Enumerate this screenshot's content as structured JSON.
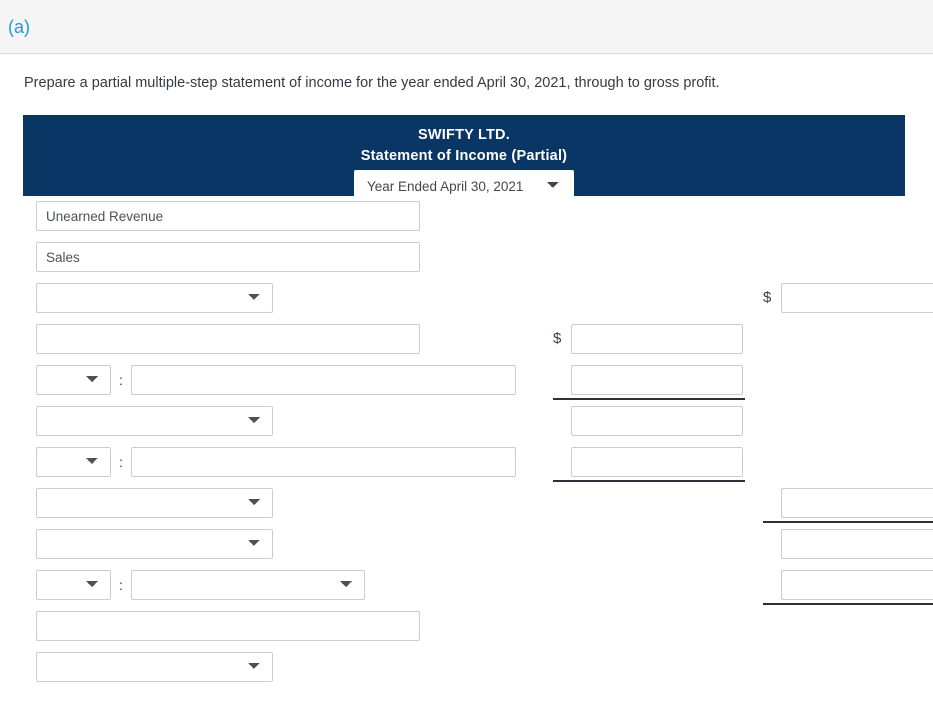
{
  "part": {
    "label": "(a)"
  },
  "instruction": "Prepare a partial multiple-step statement of income for the year ended April 30, 2021, through to gross profit.",
  "statement_header": {
    "company": "SWIFTY LTD.",
    "title": "Statement of Income (Partial)",
    "period_selected": "Year Ended April 30, 2021",
    "period_options": [
      "Year Ended April 30, 2021"
    ],
    "background_color": "#0a3665",
    "text_color": "#ffffff"
  },
  "colors": {
    "accent_link": "#1c9bdf",
    "band_background": "#f5f5f5",
    "header_navy": "#0a3665",
    "input_border": "#c9cdd1",
    "rule": "#2b3138"
  },
  "colon_symbol": ":",
  "dollar_symbol": "$",
  "rows": [
    {
      "index": 0,
      "left": {
        "kind": "text",
        "value": "Unearned Revenue",
        "placeholder": ""
      },
      "mid": null,
      "right": null
    },
    {
      "index": 1,
      "left": {
        "kind": "text",
        "value": "Sales",
        "placeholder": ""
      },
      "mid": null,
      "right": null
    },
    {
      "index": 2,
      "left": {
        "kind": "select",
        "value": "",
        "options": [
          ""
        ]
      },
      "mid": null,
      "right": {
        "kind": "amount",
        "value": "",
        "dollar": true,
        "rule_below": false
      }
    },
    {
      "index": 3,
      "left": {
        "kind": "text",
        "value": "",
        "placeholder": ""
      },
      "mid": {
        "kind": "amount",
        "value": "",
        "dollar": true,
        "rule_below": false
      },
      "right": null
    },
    {
      "index": 4,
      "left": {
        "kind": "select-colon-text",
        "select_value": "",
        "select_options": [
          ""
        ],
        "text_value": "",
        "text_placeholder": ""
      },
      "mid": {
        "kind": "amount",
        "value": "",
        "dollar": false,
        "rule_below": true
      },
      "right": null
    },
    {
      "index": 5,
      "left": {
        "kind": "select",
        "value": "",
        "options": [
          ""
        ]
      },
      "mid": {
        "kind": "amount",
        "value": "",
        "dollar": false,
        "rule_below": false
      },
      "right": null
    },
    {
      "index": 6,
      "left": {
        "kind": "select-colon-text",
        "select_value": "",
        "select_options": [
          ""
        ],
        "text_value": "",
        "text_placeholder": ""
      },
      "mid": {
        "kind": "amount",
        "value": "",
        "dollar": false,
        "rule_below": true
      },
      "right": null
    },
    {
      "index": 7,
      "left": {
        "kind": "select",
        "value": "",
        "options": [
          ""
        ]
      },
      "mid": null,
      "right": {
        "kind": "amount",
        "value": "",
        "dollar": false,
        "rule_below": true
      }
    },
    {
      "index": 8,
      "left": {
        "kind": "select",
        "value": "",
        "options": [
          ""
        ]
      },
      "mid": null,
      "right": {
        "kind": "amount",
        "value": "",
        "dollar": false,
        "rule_below": false
      }
    },
    {
      "index": 9,
      "left": {
        "kind": "select-colon-select",
        "select_value": "",
        "select_options": [
          ""
        ],
        "select2_value": "",
        "select2_options": [
          ""
        ]
      },
      "mid": null,
      "right": {
        "kind": "amount",
        "value": "",
        "dollar": false,
        "rule_below": true
      }
    },
    {
      "index": 10,
      "left": {
        "kind": "text",
        "value": "",
        "placeholder": ""
      },
      "mid": null,
      "right": null
    },
    {
      "index": 11,
      "left": {
        "kind": "select",
        "value": "",
        "options": [
          ""
        ]
      },
      "mid": null,
      "right": null
    }
  ]
}
